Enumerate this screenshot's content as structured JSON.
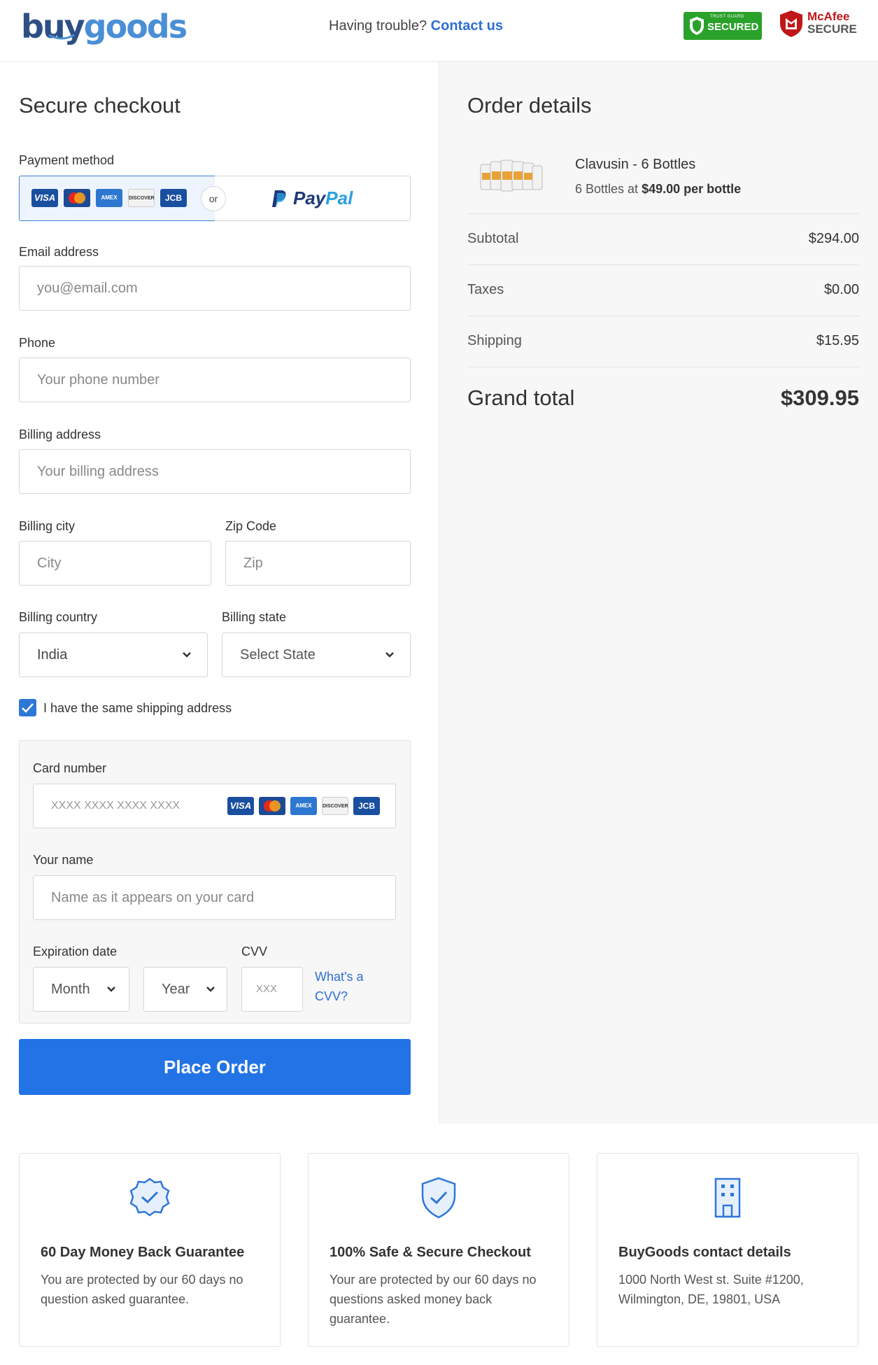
{
  "header": {
    "logo_buy": "buy",
    "logo_goods": "goods",
    "trouble_text": "Having trouble?",
    "contact_link": "Contact us",
    "badge_trustguard_small": "TRUST GUARD",
    "badge_trustguard_big": "SECURED",
    "badge_mcafee_line1": "McAfee",
    "badge_mcafee_line2": "SECURE"
  },
  "checkout": {
    "title": "Secure checkout",
    "payment_method_label": "Payment method",
    "or_label": "or",
    "paypal_p1": "Pay",
    "paypal_p2": "Pal",
    "card_logos": [
      "VISA",
      "MC",
      "AMEX",
      "DISCOVER",
      "JCB"
    ],
    "email_label": "Email address",
    "email_placeholder": "you@email.com",
    "phone_label": "Phone",
    "phone_placeholder": "Your phone number",
    "billing_address_label": "Billing address",
    "billing_address_placeholder": "Your billing address",
    "billing_city_label": "Billing city",
    "city_placeholder": "City",
    "zip_label": "Zip Code",
    "zip_placeholder": "Zip",
    "billing_country_label": "Billing country",
    "billing_country_value": "India",
    "billing_state_label": "Billing state",
    "billing_state_value": "Select State",
    "same_shipping_label": "I have the same shipping address",
    "same_shipping_checked": true,
    "card_number_label": "Card number",
    "card_number_placeholder": "XXXX XXXX XXXX XXXX",
    "your_name_label": "Your name",
    "your_name_placeholder": "Name as it appears on your card",
    "expiration_label": "Expiration date",
    "month_value": "Month",
    "year_value": "Year",
    "cvv_label": "CVV",
    "cvv_placeholder": "XXX",
    "cvv_link_line1": "What's a",
    "cvv_link_line2": "CVV?",
    "place_order_label": "Place Order"
  },
  "order": {
    "title": "Order details",
    "product_name": "Clavusin - 6 Bottles",
    "product_desc_prefix": "6 Bottles at",
    "product_desc_price": "$49.00 per bottle",
    "subtotal_label": "Subtotal",
    "subtotal_value": "$294.00",
    "taxes_label": "Taxes",
    "taxes_value": "$0.00",
    "shipping_label": "Shipping",
    "shipping_value": "$15.95",
    "grand_total_label": "Grand total",
    "grand_total_value": "$309.95"
  },
  "footer": [
    {
      "icon": "badge-check-icon",
      "title": "60 Day Money Back Guarantee",
      "text": "You are protected by our 60 days no question asked guarantee."
    },
    {
      "icon": "shield-check-icon",
      "title": "100% Safe & Secure Checkout",
      "text": "Your are protected by our 60 days no questions asked money back guarantee."
    },
    {
      "icon": "building-icon",
      "title": "BuyGoods contact details",
      "text": "1000 North West st. Suite #1200, Wilmington, DE, 19801, USA"
    }
  ],
  "colors": {
    "primary": "#2173e6",
    "link": "#2d6fd6",
    "logo_dark": "#2d4f86",
    "logo_light": "#4a8fd6",
    "right_panel_bg": "#f7f7f7"
  }
}
